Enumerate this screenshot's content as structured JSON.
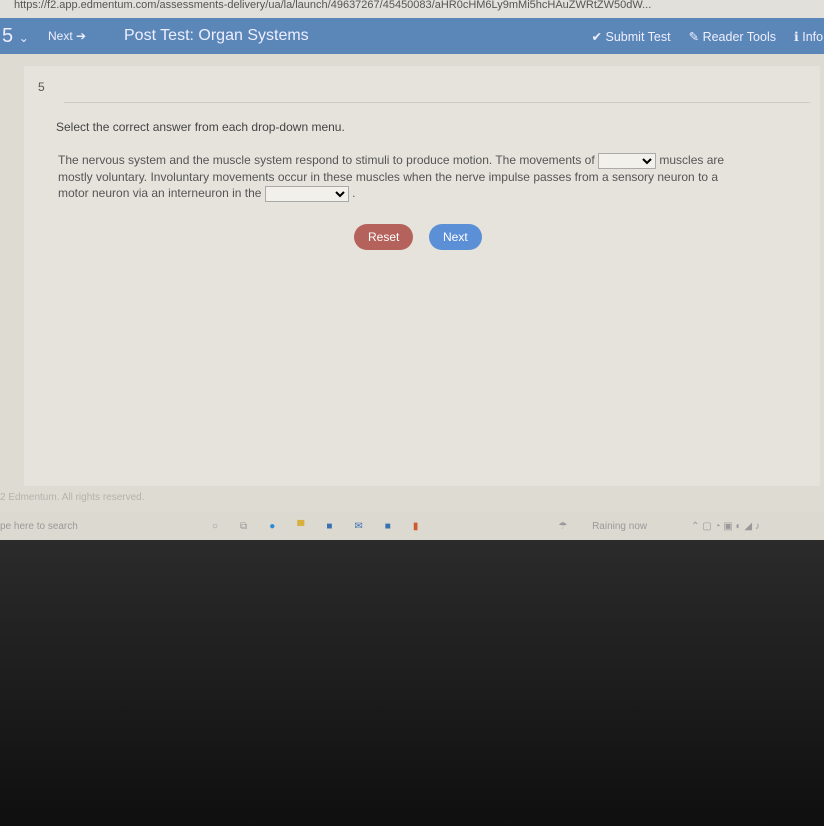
{
  "browser": {
    "url": "https://f2.app.edmentum.com/assessments-delivery/ua/la/launch/49637267/45450083/aHR0cHM6Ly9mMi5hcHAuZWRtZW50dW..."
  },
  "header": {
    "question_number": "5",
    "next_label": "Next",
    "title": "Post Test: Organ Systems",
    "submit_label": "Submit Test",
    "reader_tools_label": "Reader Tools",
    "info_label": "Info"
  },
  "question": {
    "number": "5",
    "instruction": "Select the correct answer from each drop-down menu.",
    "text_1": "The nervous system and the muscle system respond to stimuli to produce motion. The movements of",
    "text_2": "muscles are mostly voluntary. Involuntary movements occur in these muscles when the nerve impulse passes from a sensory neuron to a motor neuron via an interneuron in the",
    "text_3": ".",
    "dropdown_1": "",
    "dropdown_2": ""
  },
  "buttons": {
    "reset": "Reset",
    "next": "Next",
    "reset_color": "#b5625c",
    "next_color": "#5b8fd6"
  },
  "footer": {
    "copyright": "2 Edmentum. All rights reserved."
  },
  "taskbar": {
    "search_placeholder": "pe here to search",
    "weather": "Raining now"
  }
}
